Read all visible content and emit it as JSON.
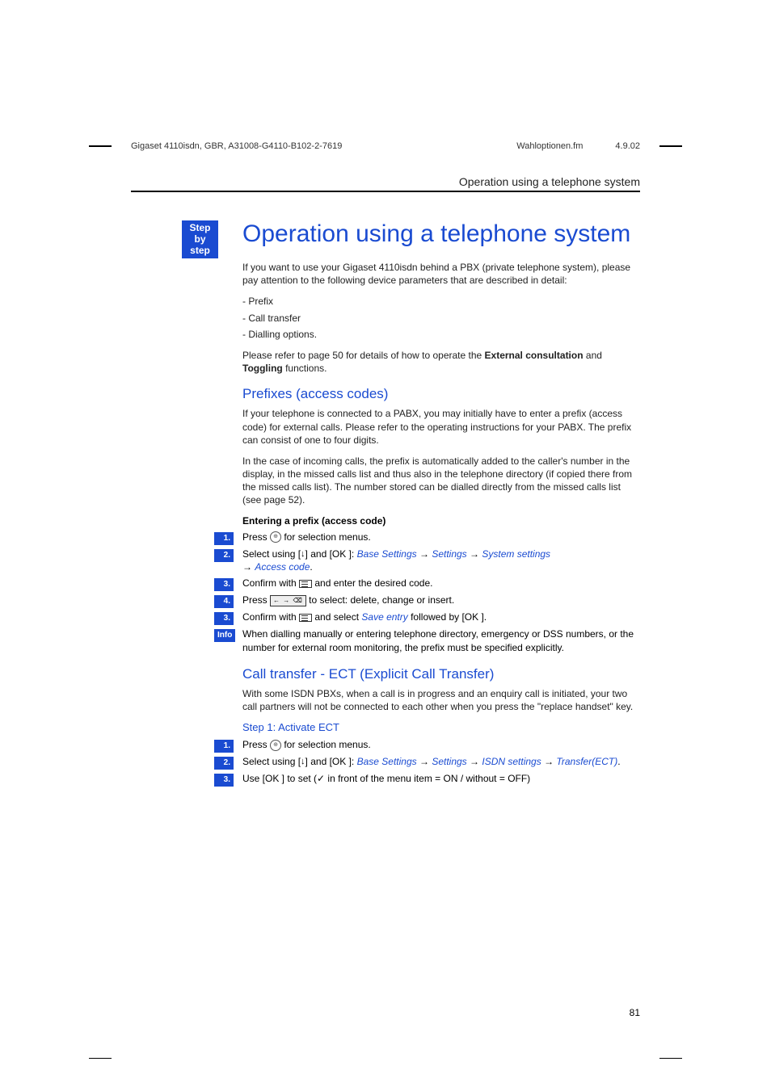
{
  "header": {
    "left": "Gigaset 4110isdn, GBR, A31008-G4110-B102-2-7619",
    "center": "Wahloptionen.fm",
    "right": "4.9.02"
  },
  "doc_title": "Operation using a telephone system",
  "sidebar": {
    "step_label": "Step\nby\nstep"
  },
  "h1": "Operation using a telephone system",
  "intro": {
    "p1": "If you want to use your Gigaset 4110isdn behind a PBX (private telephone system), please pay attention to the following device parameters that are described in detail:",
    "b1": "- Prefix",
    "b2": "- Call transfer",
    "b3": "- Dialling options.",
    "p2a": "Please refer to page 50 for details of how to operate the ",
    "p2b": "External consultation",
    "p2c": " and ",
    "p2d": "Toggling",
    "p2e": " functions."
  },
  "prefixes": {
    "h2": "Prefixes (access codes)",
    "p1": "If your telephone is connected to a PABX, you may initially have to enter a prefix (access code) for external calls. Please refer to the operating instructions for your PABX. The prefix can consist of one to four digits.",
    "p2": "In the case of incoming calls, the prefix is automatically added to the caller's number in the display, in the missed calls list and thus also in the telephone directory (if copied there from the missed calls list). The number stored can be dialled directly from the missed calls list (see page 52).",
    "enter_head": "Entering a prefix (access code)",
    "s1": {
      "badge": "1.",
      "text": "Press ",
      "after": " for selection menus."
    },
    "s2": {
      "badge": "2.",
      "pre": "Select using [",
      "mid": "] and [OK ]: ",
      "l1": "Base Settings",
      "l2": "Settings",
      "l3": "System settings",
      "l4": "Access code",
      "dot": "."
    },
    "s3": {
      "badge": "3.",
      "pre": "Confirm with ",
      "post": " and enter the desired code."
    },
    "s4": {
      "badge": "4.",
      "pre": "Press ",
      "post": " to select: delete, change or insert."
    },
    "s5": {
      "badge": "3.",
      "pre": "Confirm with ",
      "mid": " and select ",
      "link": "Save entry",
      "post": " followed by [OK ]."
    },
    "info": {
      "badge": "Info",
      "text": "When dialling manually or entering telephone directory, emergency or DSS numbers, or the number for external room monitoring, the prefix must be specified explicitly."
    }
  },
  "ect": {
    "h2": "Call transfer - ECT (Explicit Call Transfer)",
    "p1": "With some ISDN PBXs, when a call is in progress and an enquiry call is initiated, your two call partners will not be connected to each other when you press the \"replace handset\" key.",
    "h3": "Step 1: Activate ECT",
    "s1": {
      "badge": "1.",
      "text": "Press ",
      "after": " for selection menus."
    },
    "s2": {
      "badge": "2.",
      "pre": "Select using [",
      "mid": "] and [OK ]: ",
      "l1": "Base Settings",
      "l2": "Settings",
      "l3": "ISDN settings",
      "l4": "Transfer(ECT)",
      "dot": "."
    },
    "s3": {
      "badge": "3.",
      "text": "Use [OK ] to set (✓ in front of the menu item = ON / without = OFF)"
    }
  },
  "page_number": "81",
  "arrow": "→"
}
